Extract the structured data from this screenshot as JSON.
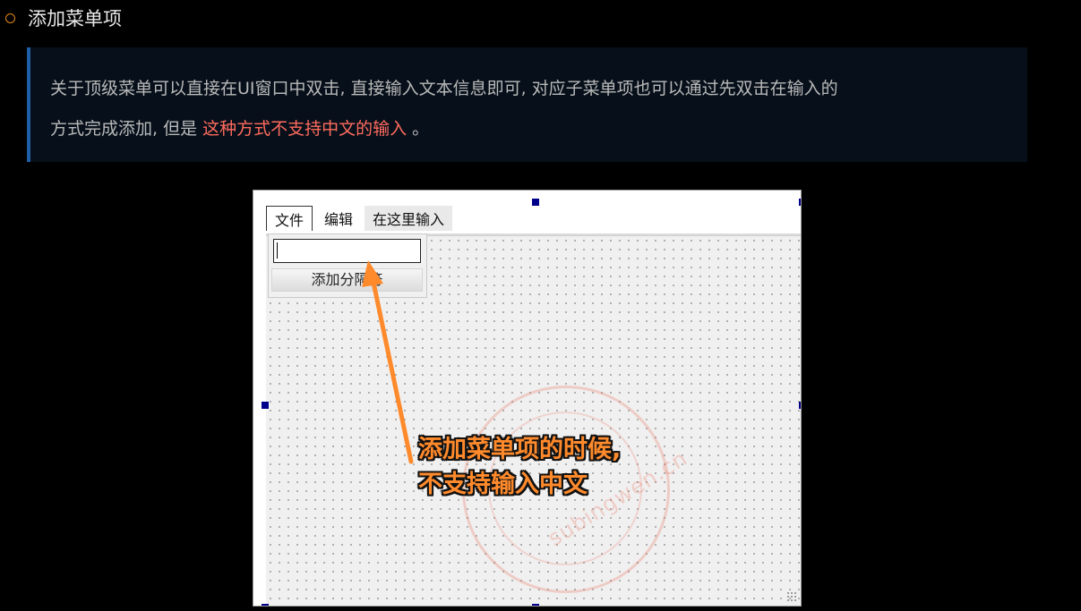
{
  "heading": {
    "icon": "hollow-circle-bullet",
    "text": "添加菜单项"
  },
  "note": {
    "line1": "关于顶级菜单可以直接在UI窗口中双击, 直接输入文本信息即可, 对应子菜单项也可以通过先双击在输入的",
    "line2_prefix": "方式完成添加, 但是 ",
    "line2_highlight": "这种方式不支持中文的输入",
    "line2_suffix": " 。",
    "highlight_color": "#ff6b5e",
    "border_color": "#1f5fa8"
  },
  "screenshot": {
    "menu": {
      "items": [
        "文件",
        "编辑",
        "在这里输入"
      ]
    },
    "dropdown": {
      "input_value": "",
      "button_label": "添加分隔符"
    },
    "callout": {
      "line1": "添加菜单项的时候,",
      "line2": "不支持输入中文",
      "color": "#ff8a2c"
    },
    "watermark_text": "subingwen.cn"
  }
}
